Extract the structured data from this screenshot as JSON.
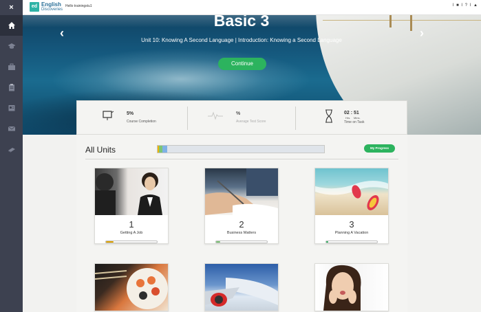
{
  "sidebar": {
    "close_label": "×",
    "items": [
      {
        "icon": "home-icon"
      },
      {
        "icon": "graduation-cap-icon"
      },
      {
        "icon": "briefcase-icon"
      },
      {
        "icon": "clipboard-icon"
      },
      {
        "icon": "document-icon"
      },
      {
        "icon": "mail-icon"
      },
      {
        "icon": "book-icon"
      }
    ]
  },
  "topbar": {
    "logo_mark": "ed",
    "logo_line1": "English",
    "logo_line2": "Discoveries",
    "greeting": "Hello trainingstu1",
    "icons_text": "I ■ I ? I ▲"
  },
  "hero": {
    "title": "Basic 3",
    "subtitle": "Unit 10: Knowing A Second Language | Introduction: Knowing a Second Language",
    "continue_label": "Continue",
    "prev_label": "‹",
    "next_label": "›"
  },
  "stats": {
    "completion_value": "5%",
    "completion_label": "Course Completion",
    "score_value": "%",
    "score_label": "Average Test Score",
    "time_value": "02 : 51",
    "time_hrs": "Hrs.",
    "time_mins": "Mins.",
    "time_label": "Time on Task"
  },
  "units": {
    "title": "All Units",
    "my_progress_label": "My Progress",
    "progress_segments": [
      {
        "color": "#f0b400",
        "fraction": 0.01
      },
      {
        "color": "#7cc576",
        "fraction": 0.02
      },
      {
        "color": "#7fb2e5",
        "fraction": 0.03
      }
    ],
    "cards": [
      {
        "number": "1",
        "name": "Getting A Job",
        "progress": 0.15,
        "progress_color": "#e0a400"
      },
      {
        "number": "2",
        "name": "Business Matters",
        "progress": 0.08,
        "progress_color": "#7cc576"
      },
      {
        "number": "3",
        "name": "Planning A Vacation",
        "progress": 0.04,
        "progress_color": "#2cb35e"
      },
      {
        "number": "",
        "name": "",
        "progress": 0
      },
      {
        "number": "",
        "name": "",
        "progress": 0
      },
      {
        "number": "",
        "name": "",
        "progress": 0
      }
    ]
  }
}
